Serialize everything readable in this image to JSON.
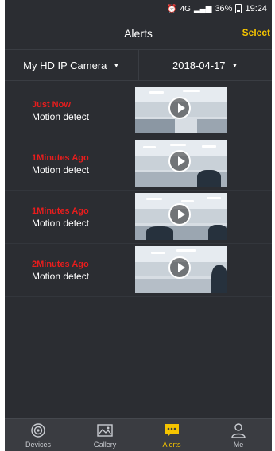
{
  "status": {
    "network": "4G",
    "battery": "36%",
    "time": "19:24"
  },
  "header": {
    "title": "Alerts",
    "select_label": "Select"
  },
  "filters": {
    "camera": "My HD IP Camera",
    "date": "2018-04-17"
  },
  "alerts": [
    {
      "time": "Just Now",
      "event": "Motion detect"
    },
    {
      "time": "1Minutes Ago",
      "event": "Motion detect"
    },
    {
      "time": "1Minutes Ago",
      "event": "Motion detect"
    },
    {
      "time": "2Minutes Ago",
      "event": "Motion detect"
    }
  ],
  "tabs": [
    {
      "label": "Devices",
      "icon": "camera-icon"
    },
    {
      "label": "Gallery",
      "icon": "image-icon"
    },
    {
      "label": "Alerts",
      "icon": "message-icon",
      "active": true
    },
    {
      "label": "Me",
      "icon": "person-icon"
    }
  ],
  "colors": {
    "accent": "#f5c400",
    "alert_time": "#e81d1d",
    "background": "#2b2d32"
  }
}
